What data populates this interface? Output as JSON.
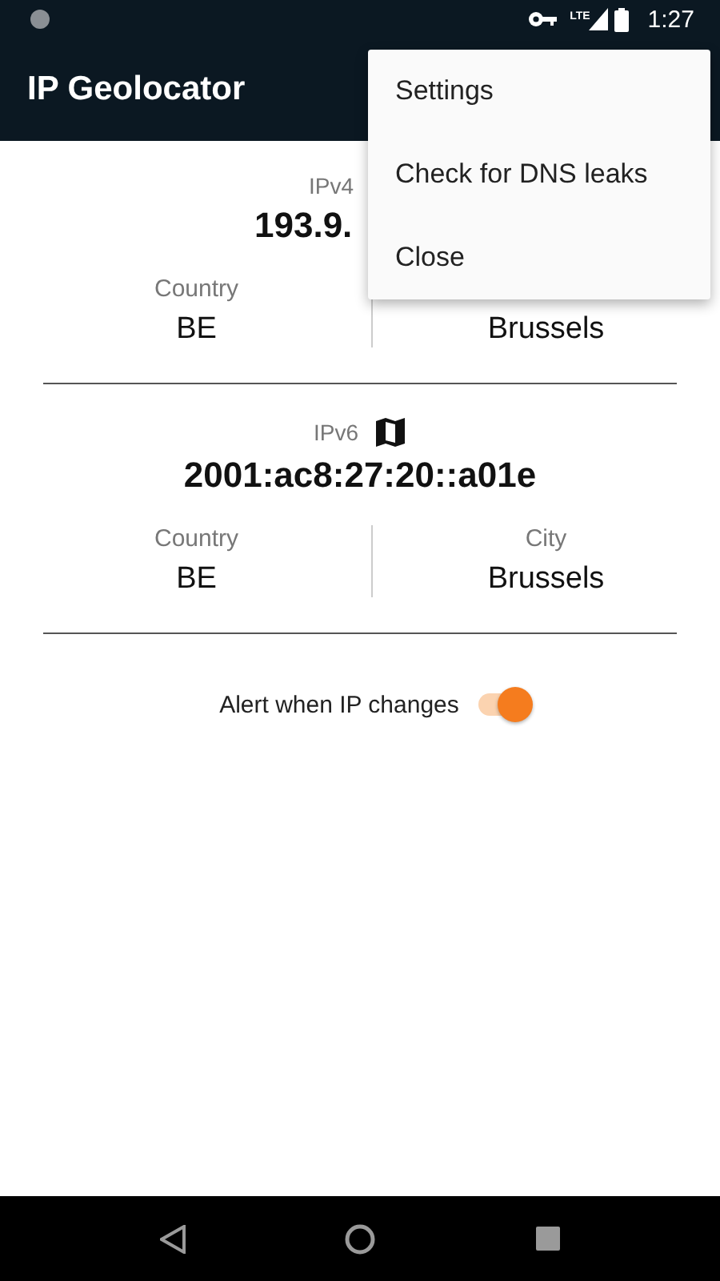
{
  "status_bar": {
    "network": "LTE",
    "time": "1:27"
  },
  "app_bar": {
    "title": "IP Geolocator"
  },
  "menu": {
    "items": [
      {
        "label": "Settings"
      },
      {
        "label": "Check for DNS leaks"
      },
      {
        "label": "Close"
      }
    ]
  },
  "ipv4": {
    "label": "IPv4",
    "address": "193.9.",
    "country_label": "Country",
    "country": "BE",
    "city": "Brussels"
  },
  "ipv6": {
    "label": "IPv6",
    "address": "2001:ac8:27:20::a01e",
    "country_label": "Country",
    "country": "BE",
    "city_label": "City",
    "city": "Brussels"
  },
  "alert": {
    "label": "Alert when IP changes",
    "on": true
  }
}
